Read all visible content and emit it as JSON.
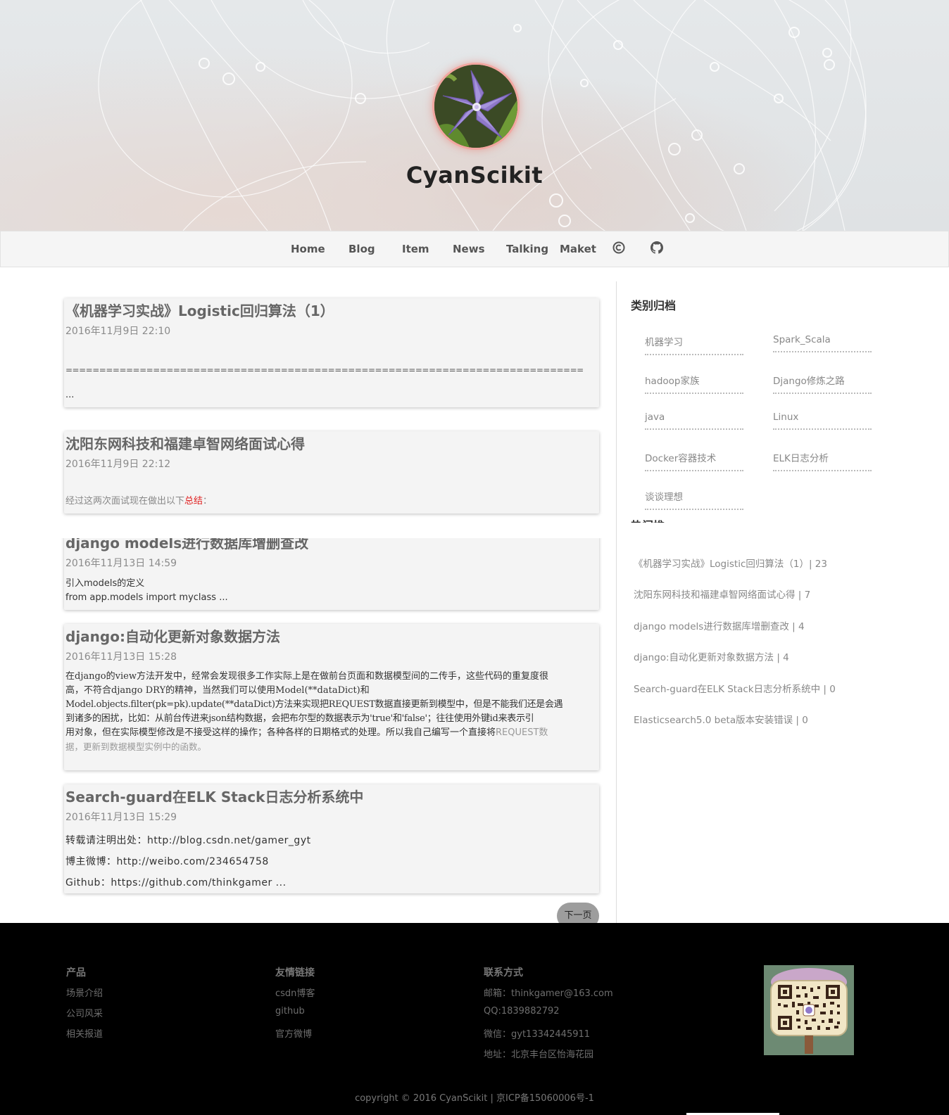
{
  "site": {
    "title": "CyanScikit"
  },
  "nav": {
    "items": [
      "Home",
      "Blog",
      "Item",
      "News",
      "Talking",
      "Maket"
    ],
    "icons": [
      "copyright-icon",
      "github-icon"
    ]
  },
  "posts": [
    {
      "title": "《机器学习实战》Logistic回归算法（1）",
      "date": "2016年11月9日 22:10",
      "excerpt_line1": "=============================================================================",
      "excerpt_line2": "..."
    },
    {
      "title": "沈阳东网科技和福建卓智网络面试心得",
      "date": "2016年11月9日 22:12",
      "excerpt_prefix": "经过这两次面试现在做出以下",
      "excerpt_highlight": "总结",
      "excerpt_suffix": "："
    },
    {
      "title": "django models进行数据库增删查改",
      "date": "2016年11月13日 14:59",
      "excerpt_line1": "引入models的定义",
      "excerpt_line2": "from app.models import  myclass ..."
    },
    {
      "title": "django:自动化更新对象数据方法",
      "date": "2016年11月13日 15:28",
      "excerpt_line1": "  在django的view方法开发中，经常会发现很多工作实际上是在做前台页面和数据模型间的二传手，这些代码的重复度很",
      "excerpt_line2": "高，不符合django DRY的精神，当然我们可以使用Model(**dataDict)和",
      "excerpt_line3": "Model.objects.filter(pk=pk).update(**dataDict)方法来实现把REQUEST数据直接更新到模型中，但是不能我们还是会遇",
      "excerpt_line4": "到诸多的困扰，比如：从前台传进来json结构数据，会把布尔型的数据表示为'true'和'false'；往往使用外键id来表示引",
      "excerpt_line5": "用对象，但在实际模型修改是不接受这样的操作；各种各样的日期格式的处理。所以我自己编写一个直接将",
      "excerpt_grey1": "REQUEST数",
      "excerpt_grey2": "据，更新到数据模型实例中的函数。"
    },
    {
      "title": "Search-guard在ELK Stack日志分析系统中",
      "date": "2016年11月13日 15:29",
      "excerpt_line1": "转载请注明出处：http://blog.csdn.net/gamer_gyt",
      "excerpt_line2": "博主微博：http://weibo.com/234654758",
      "excerpt_line3": "Github：https://github.com/thinkgamer ..."
    }
  ],
  "pagination": {
    "next": "下一页"
  },
  "sidebar": {
    "categories_title": "类别归档",
    "categories": [
      "机器学习",
      "Spark_Scala",
      "hadoop家族",
      "Django修炼之路",
      "java",
      "Linux",
      "Docker容器技术",
      "ELK日志分析",
      "谈谈理想"
    ],
    "hot_title": "热门推荐",
    "hot": [
      "《机器学习实战》Logistic回归算法（1）| 23",
      "沈阳东网科技和福建卓智网络面试心得 | 7",
      "django models进行数据库增删查改 | 4",
      "django:自动化更新对象数据方法 | 4",
      "Search-guard在ELK Stack日志分析系统中 | 0",
      "Elasticsearch5.0 beta版本安装错误 | 0"
    ]
  },
  "footer": {
    "product": {
      "title": "产品",
      "items": [
        "场景介绍",
        "公司风采",
        "相关报道"
      ]
    },
    "links": {
      "title": "友情链接",
      "items": [
        "csdn博客",
        "github",
        "官方微博"
      ]
    },
    "contact": {
      "title": "联系方式",
      "items": [
        "邮箱：thinkgamer@163.com",
        "QQ:1839882792",
        "微信：gyt13342445911",
        "地址：北京丰台区怡海花园"
      ]
    },
    "copyright": "copyright © 2016 CyanScikit | 京ICP备15060006号-1"
  }
}
